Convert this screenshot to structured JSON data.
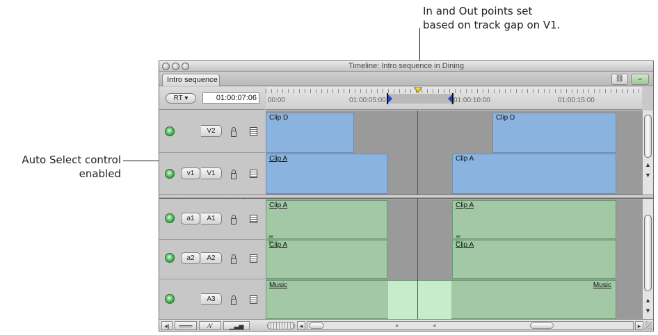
{
  "annotations": {
    "top_line1": "In and Out points set",
    "top_line2": "based on track gap on V1.",
    "left_line1": "Auto Select control",
    "left_line2": "enabled"
  },
  "window": {
    "title": "Timeline: Intro sequence in Dining",
    "tab_label": "Intro sequence"
  },
  "controls": {
    "rt_label": "RT ▾",
    "timecode": "01:00:07:06"
  },
  "ruler": {
    "labels": [
      "00:00",
      "01:00:05:00",
      "01:00:10:00",
      "01:00:15:00"
    ]
  },
  "tracks": {
    "v2": {
      "target": "V2"
    },
    "v1": {
      "source": "v1",
      "target": "V1"
    },
    "a1": {
      "source": "a1",
      "target": "A1"
    },
    "a2": {
      "source": "a2",
      "target": "A2"
    },
    "a3": {
      "target": "A3"
    }
  },
  "clips": {
    "v2_left": "Clip D",
    "v2_right": "Clip D",
    "v1_left": "Clip A",
    "v1_right": "Clip A",
    "a1_left": "Clip A",
    "a1_right": "Clip A",
    "a2_left": "Clip A",
    "a2_right": "Clip A",
    "a3_left": "Music",
    "a3_right": "Music"
  }
}
